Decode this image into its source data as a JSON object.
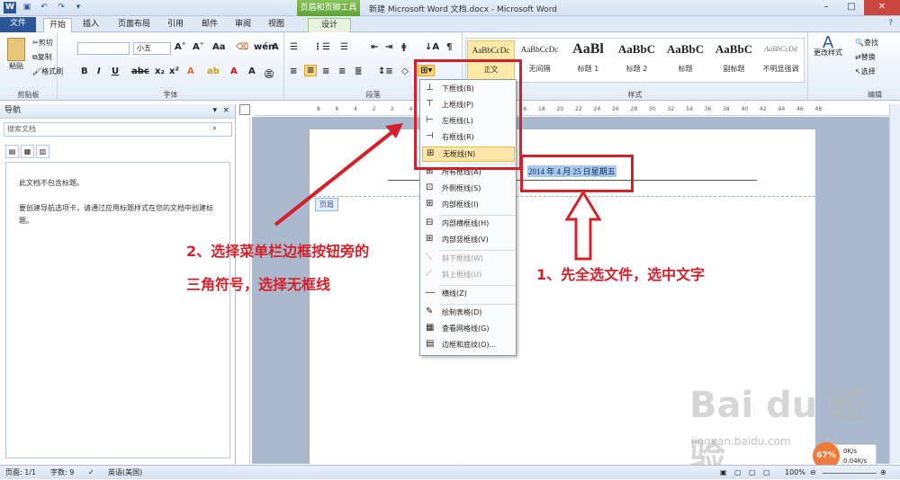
{
  "app": {
    "title": "新建 Microsoft Word 文档.docx - Microsoft Word",
    "context_tab_title": "页眉和页脚工具"
  },
  "tabs": [
    "文件",
    "开始",
    "插入",
    "页面布局",
    "引用",
    "邮件",
    "审阅",
    "视图",
    "设计"
  ],
  "ribbon": {
    "clipboard": {
      "paste": "粘贴",
      "cut": "剪切",
      "copy": "复制",
      "format_painter": "格式刷",
      "label": "剪贴板"
    },
    "font": {
      "font_size": "小五",
      "label": "字体"
    },
    "paragraph": {
      "label": "段落"
    },
    "styles": {
      "label": "样式",
      "items": [
        {
          "sample": "AaBbCcDc",
          "name": "正文"
        },
        {
          "sample": "AaBbCcDc",
          "name": "无间隔"
        },
        {
          "sample": "AaBl",
          "name": "标题 1"
        },
        {
          "sample": "AaBbC",
          "name": "标题 2"
        },
        {
          "sample": "AaBbC",
          "name": "标题"
        },
        {
          "sample": "AaBbC",
          "name": "副标题"
        },
        {
          "sample": "AaBbCcDd",
          "name": "不明显强调"
        }
      ],
      "change_styles": "更改样式"
    },
    "editing": {
      "find": "查找",
      "replace": "替换",
      "select": "选择",
      "label": "编辑"
    }
  },
  "nav": {
    "title": "导航",
    "search_placeholder": "搜索文档",
    "body_line1": "此文档不包含标题。",
    "body_line2": "要创建导航选项卡，请通过应用标题样式在您的文档中创建标题。"
  },
  "ruler": {
    "ticks": [
      "8",
      "6",
      "4",
      "2",
      "2",
      "4",
      "6",
      "8",
      "10",
      "12",
      "14",
      "16",
      "18",
      "20",
      "22",
      "24",
      "26",
      "28",
      "30",
      "32",
      "34",
      "36",
      "38",
      "40",
      "42",
      "44",
      "46",
      "48"
    ]
  },
  "document": {
    "date_text": "2014 年 4 月 25 日星期五",
    "header_tag": "页眉"
  },
  "border_menu": {
    "items": [
      {
        "label": "下框线(B)",
        "disabled": false
      },
      {
        "label": "上框线(P)",
        "disabled": false
      },
      {
        "label": "左框线(L)",
        "disabled": false
      },
      {
        "label": "右框线(R)",
        "disabled": false
      },
      {
        "label": "无框线(N)",
        "disabled": false
      },
      {
        "label": "所有框线(A)",
        "disabled": false
      },
      {
        "label": "外侧框线(S)",
        "disabled": false
      },
      {
        "label": "内部框线(I)",
        "disabled": false
      },
      {
        "label": "内部横框线(H)",
        "disabled": false
      },
      {
        "label": "内部竖框线(V)",
        "disabled": false
      },
      {
        "label": "斜下框线(W)",
        "disabled": true
      },
      {
        "label": "斜上框线(U)",
        "disabled": true
      },
      {
        "label": "横线(Z)",
        "disabled": false
      },
      {
        "label": "绘制表格(D)",
        "disabled": false
      },
      {
        "label": "查看网格线(G)",
        "disabled": false
      },
      {
        "label": "边框和底纹(O)...",
        "disabled": false
      }
    ]
  },
  "annotations": {
    "step1": "1、先全选文件，选中文字",
    "step2_line1": "2、选择菜单栏边框按钮旁的",
    "step2_line2": "三角符号，选择无框线"
  },
  "statusbar": {
    "page": "页面: 1/1",
    "words": "字数: 9",
    "language": "英语(美国)",
    "zoom": "100%"
  },
  "netmeter": {
    "percent": "67%",
    "up": "0K/s",
    "down": "0.04K/s"
  },
  "watermark": {
    "brand": "Bai du 经验",
    "url": "jingyan.baidu.com"
  },
  "colors": {
    "accent": "#2b579a",
    "annotation_red": "#d4202a",
    "context_green": "#5fa238",
    "selection": "#a6c8ec"
  }
}
